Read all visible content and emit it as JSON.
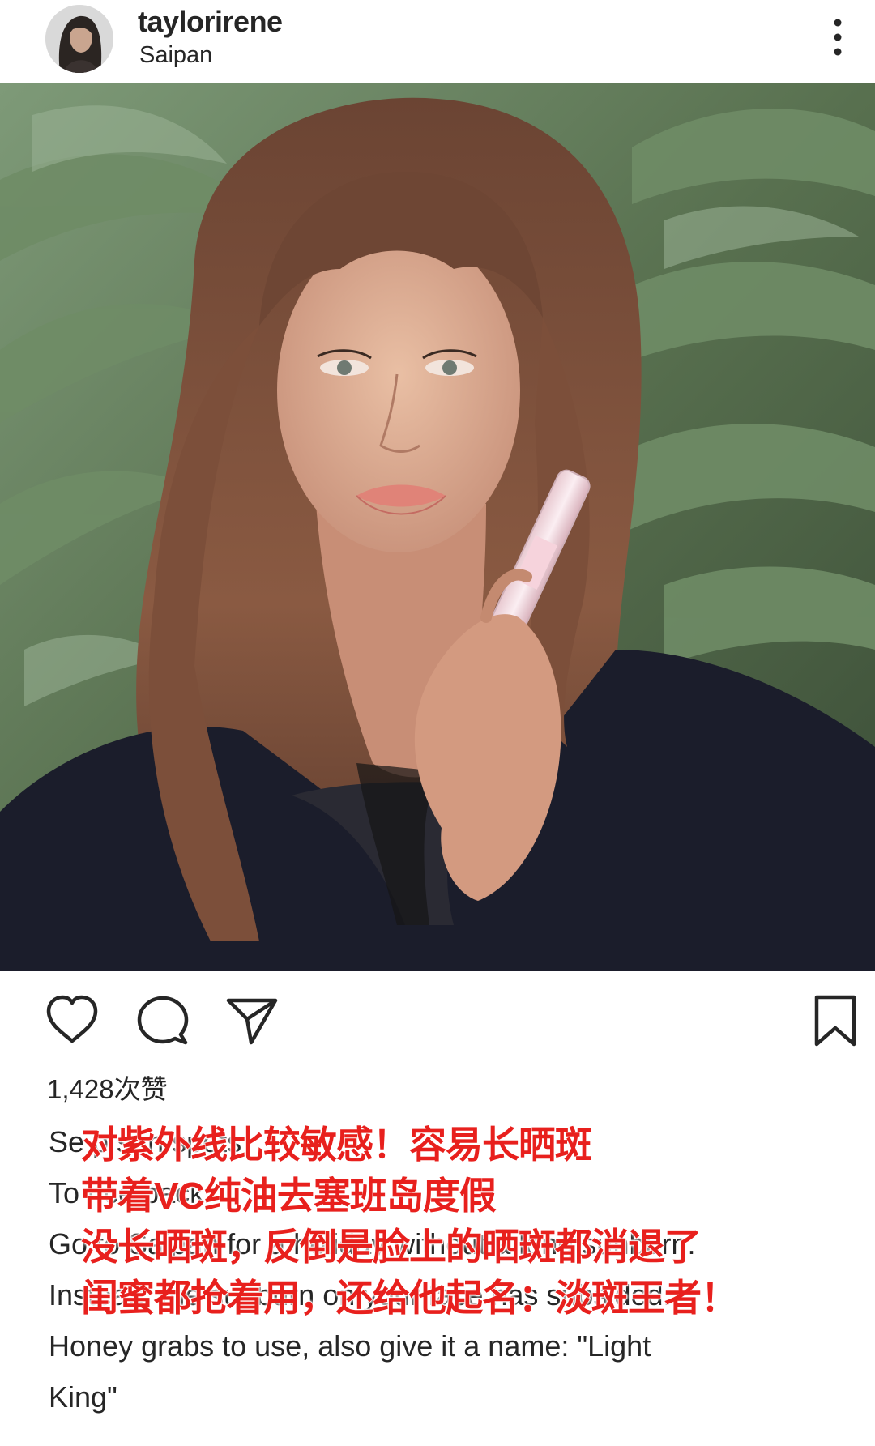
{
  "header": {
    "username": "taylorirene",
    "location": "Saipan",
    "more_icon": "more-vertical-icon"
  },
  "post": {
    "image_icon": "post-photo"
  },
  "actions": {
    "like_icon": "heart-icon",
    "comment_icon": "comment-icon",
    "share_icon": "send-icon",
    "save_icon": "bookmark-icon"
  },
  "likes": {
    "text": "1,428次赞"
  },
  "caption": {
    "lines": [
      "Se                                    p              sun spots",
      "To                                               nce back",
      "Go to Saipan for a holiday without a long sunburn.",
      "Instead, the sunburn on your face has subsided.",
      "Honey grabs to use, also give it a name: \"Light",
      "King\""
    ]
  },
  "overlay": {
    "lines": [
      "对紫外线比较敏感！容易长晒斑",
      "带着VC纯油去塞班岛度假",
      "没长晒斑，反倒是脸上的晒斑都消退了",
      "闺蜜都抢着用，还给他起名：淡斑王者！"
    ],
    "color": "#e8201d"
  }
}
